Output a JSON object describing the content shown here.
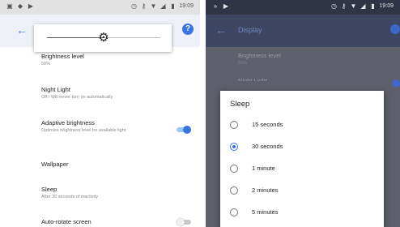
{
  "colors": {
    "accent": "#3a74e0",
    "left_background": "#ffffff",
    "dimmed_background": "#5d606a",
    "dialog_background": "#ffffff"
  },
  "left_screen": {
    "status_bar": {
      "left_icons": [
        "image-icon",
        "signal-4g-icon",
        "play-store-icon"
      ],
      "right_icons": [
        "alarm-icon",
        "vpn-key-icon",
        "wifi-icon",
        "cell-signal-icon",
        "battery-icon"
      ],
      "time": "19:09"
    },
    "brightness_slider": {
      "level_fraction": 0.5
    },
    "settings": [
      {
        "title": "Brightness level",
        "summary": "50%"
      },
      {
        "title": "Night Light",
        "summary": "Off / Will never turn on automatically"
      },
      {
        "title": "Adaptive brightness",
        "summary": "Optimize brightness level for available light",
        "toggle": true
      },
      {
        "title": "Wallpaper",
        "summary": ""
      },
      {
        "title": "Sleep",
        "summary": "After 30 seconds of inactivity"
      },
      {
        "title": "Auto-rotate screen",
        "summary": "",
        "toggle": false
      }
    ]
  },
  "right_screen": {
    "status_bar": {
      "left_icons": [
        "double-arrow-icon",
        "play-store-icon"
      ],
      "right_icons": [
        "alarm-icon",
        "vpn-key-icon",
        "wifi-icon",
        "cell-signal-icon",
        "battery-icon"
      ],
      "time": "19:09"
    },
    "app_bar": {
      "title": "Display"
    },
    "background_setting": {
      "title": "Brightness level",
      "summary": "50%"
    },
    "background_cut_text": "Night Light",
    "sleep_dialog": {
      "title": "Sleep",
      "options": [
        {
          "label": "15 seconds",
          "selected": false
        },
        {
          "label": "30 seconds",
          "selected": true
        },
        {
          "label": "1 minute",
          "selected": false
        },
        {
          "label": "2 minutes",
          "selected": false
        },
        {
          "label": "5 minutes",
          "selected": false
        }
      ]
    }
  }
}
